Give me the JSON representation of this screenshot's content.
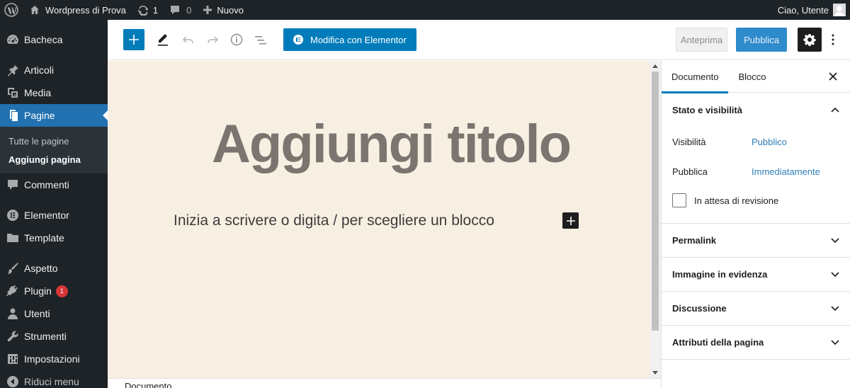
{
  "adminbar": {
    "site_name": "Wordpress di Prova",
    "updates_count": "1",
    "comments_count": "0",
    "new_label": "Nuovo",
    "greeting": "Ciao, Utente"
  },
  "sidebar": {
    "items": [
      {
        "label": "Bacheca",
        "icon": "dashboard-icon"
      },
      {
        "label": "Articoli",
        "icon": "pin-icon"
      },
      {
        "label": "Media",
        "icon": "media-icon"
      },
      {
        "label": "Pagine",
        "icon": "pages-icon"
      },
      {
        "label": "Commenti",
        "icon": "comment-icon"
      },
      {
        "label": "Elementor",
        "icon": "elementor-icon"
      },
      {
        "label": "Template",
        "icon": "folder-icon"
      },
      {
        "label": "Aspetto",
        "icon": "brush-icon"
      },
      {
        "label": "Plugin",
        "icon": "plugin-icon",
        "badge": "1"
      },
      {
        "label": "Utenti",
        "icon": "user-icon"
      },
      {
        "label": "Strumenti",
        "icon": "wrench-icon"
      },
      {
        "label": "Impostazioni",
        "icon": "settings-icon"
      },
      {
        "label": "Riduci menu",
        "icon": "collapse-icon"
      }
    ],
    "submenu": [
      "Tutte le pagine",
      "Aggiungi pagina"
    ]
  },
  "toolbar": {
    "elementor_label": "Modifica con Elementor",
    "preview_label": "Anteprima",
    "publish_label": "Pubblica"
  },
  "editor": {
    "title_placeholder": "Aggiungi titolo",
    "block_placeholder": "Inizia a scrivere o digita / per scegliere un blocco"
  },
  "footer": {
    "breadcrumb": "Documento"
  },
  "panel": {
    "tabs": [
      "Documento",
      "Blocco"
    ],
    "status_section": {
      "title": "Stato e visibilità",
      "visibility_label": "Visibilità",
      "visibility_value": "Pubblico",
      "publish_label": "Pubblica",
      "publish_value": "Immediatamente",
      "pending_label": "In attesa di revisione"
    },
    "sections": [
      "Permalink",
      "Immagine in evidenza",
      "Discussione",
      "Attributi della pagina"
    ]
  },
  "colors": {
    "admin_dark": "#1d2327",
    "accent": "#007cba",
    "canvas_bg": "#f7efe2",
    "badge": "#d63638"
  }
}
